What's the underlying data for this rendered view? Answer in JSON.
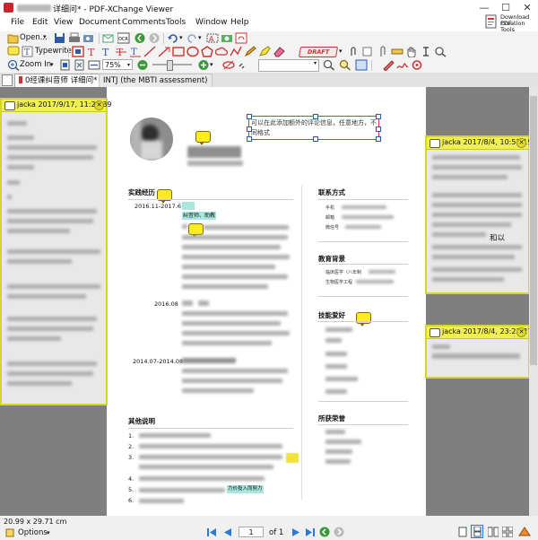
{
  "window": {
    "title": "详细问* - PDF-XChange Viewer",
    "minimize": "—",
    "maximize": "☐",
    "close": "✕"
  },
  "menu": [
    "File",
    "Edit",
    "View",
    "Document",
    "Comments",
    "Tools",
    "Window",
    "Help"
  ],
  "promo": {
    "line1": "Download PDF",
    "line2": "Creation Tools"
  },
  "toolbar1": {
    "open_label": "Open..."
  },
  "toolbar2": {
    "typewriter_label": "Typewriter",
    "draft_stamp": "DRAFT"
  },
  "toolbar3": {
    "zoom_in_label": "Zoom In",
    "zoom_value": "75%"
  },
  "tabs": [
    {
      "label": "0经课纠音师 详细问*",
      "active": true
    },
    {
      "label": "INTJ (the MBTI assessment)",
      "active": false
    }
  ],
  "notes": [
    {
      "author_date": "jacka 2017/9/17, 11:23:39"
    },
    {
      "author_date": "jacka  2017/8/4, 10:52:19",
      "visible_text": "和以"
    },
    {
      "author_date": "jacka  2017/8/4, 23:23:27"
    }
  ],
  "document": {
    "annotation_text": "可以在此添加额外的评论信息，任意地方，不同格式",
    "sections": {
      "experience": "实践经历",
      "contact": "联系方式",
      "education": "教育背景",
      "skills": "技能爱好",
      "other": "其他说明",
      "honors": "所获荣誉"
    },
    "dates": [
      "2016.11-2017.6",
      "2016.08",
      "2014.07-2014.08"
    ],
    "contact_labels": [
      "手机",
      "邮箱",
      "微信号"
    ],
    "education_items": [
      "临床医学（八年制",
      "生物医学工程"
    ],
    "highlight_1": "纠音师、助教",
    "highlight_2": "力价投入而努力",
    "list_numbers": [
      "1.",
      "2.",
      "3.",
      "4.",
      "5.",
      "6."
    ]
  },
  "status": {
    "page_size": "20.99 x 29.71 cm",
    "options_label": "Options",
    "page_number": "1",
    "page_of": "of 1"
  }
}
